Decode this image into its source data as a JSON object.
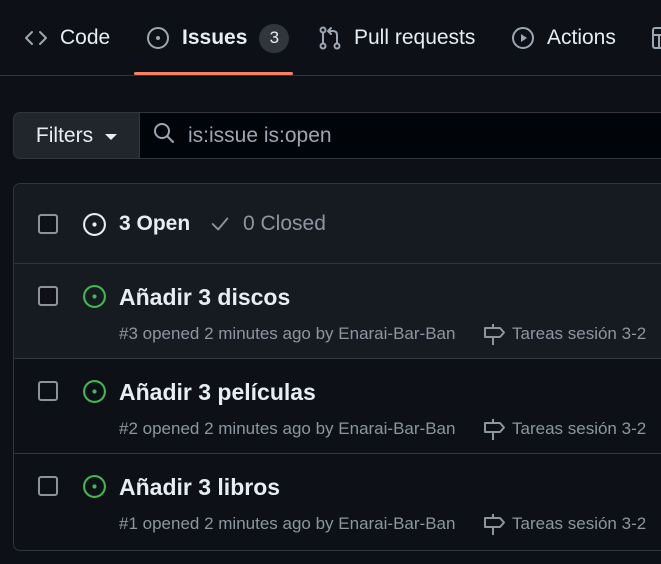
{
  "tabs": [
    {
      "label": "Code",
      "icon": "code-icon"
    },
    {
      "label": "Issues",
      "icon": "issue-opened-icon",
      "count": "3",
      "active": true
    },
    {
      "label": "Pull requests",
      "icon": "git-pull-request-icon"
    },
    {
      "label": "Actions",
      "icon": "play-icon"
    }
  ],
  "filters": {
    "button_label": "Filters",
    "search_value": "is:issue is:open"
  },
  "list_header": {
    "open_label": "3 Open",
    "closed_label": "0 Closed"
  },
  "issues": [
    {
      "title": "Añadir 3 discos",
      "meta": "#3 opened 2 minutes ago by Enarai-Bar-Ban",
      "milestone": "Tareas sesión 3-2"
    },
    {
      "title": "Añadir 3 películas",
      "meta": "#2 opened 2 minutes ago by Enarai-Bar-Ban",
      "milestone": "Tareas sesión 3-2"
    },
    {
      "title": "Añadir 3 libros",
      "meta": "#1 opened 2 minutes ago by Enarai-Bar-Ban",
      "milestone": "Tareas sesión 3-2"
    }
  ],
  "colors": {
    "background": "#0d1117",
    "accent_underline": "#f78166",
    "open_issue_green": "#3fb950",
    "muted_text": "#8d96a0"
  }
}
